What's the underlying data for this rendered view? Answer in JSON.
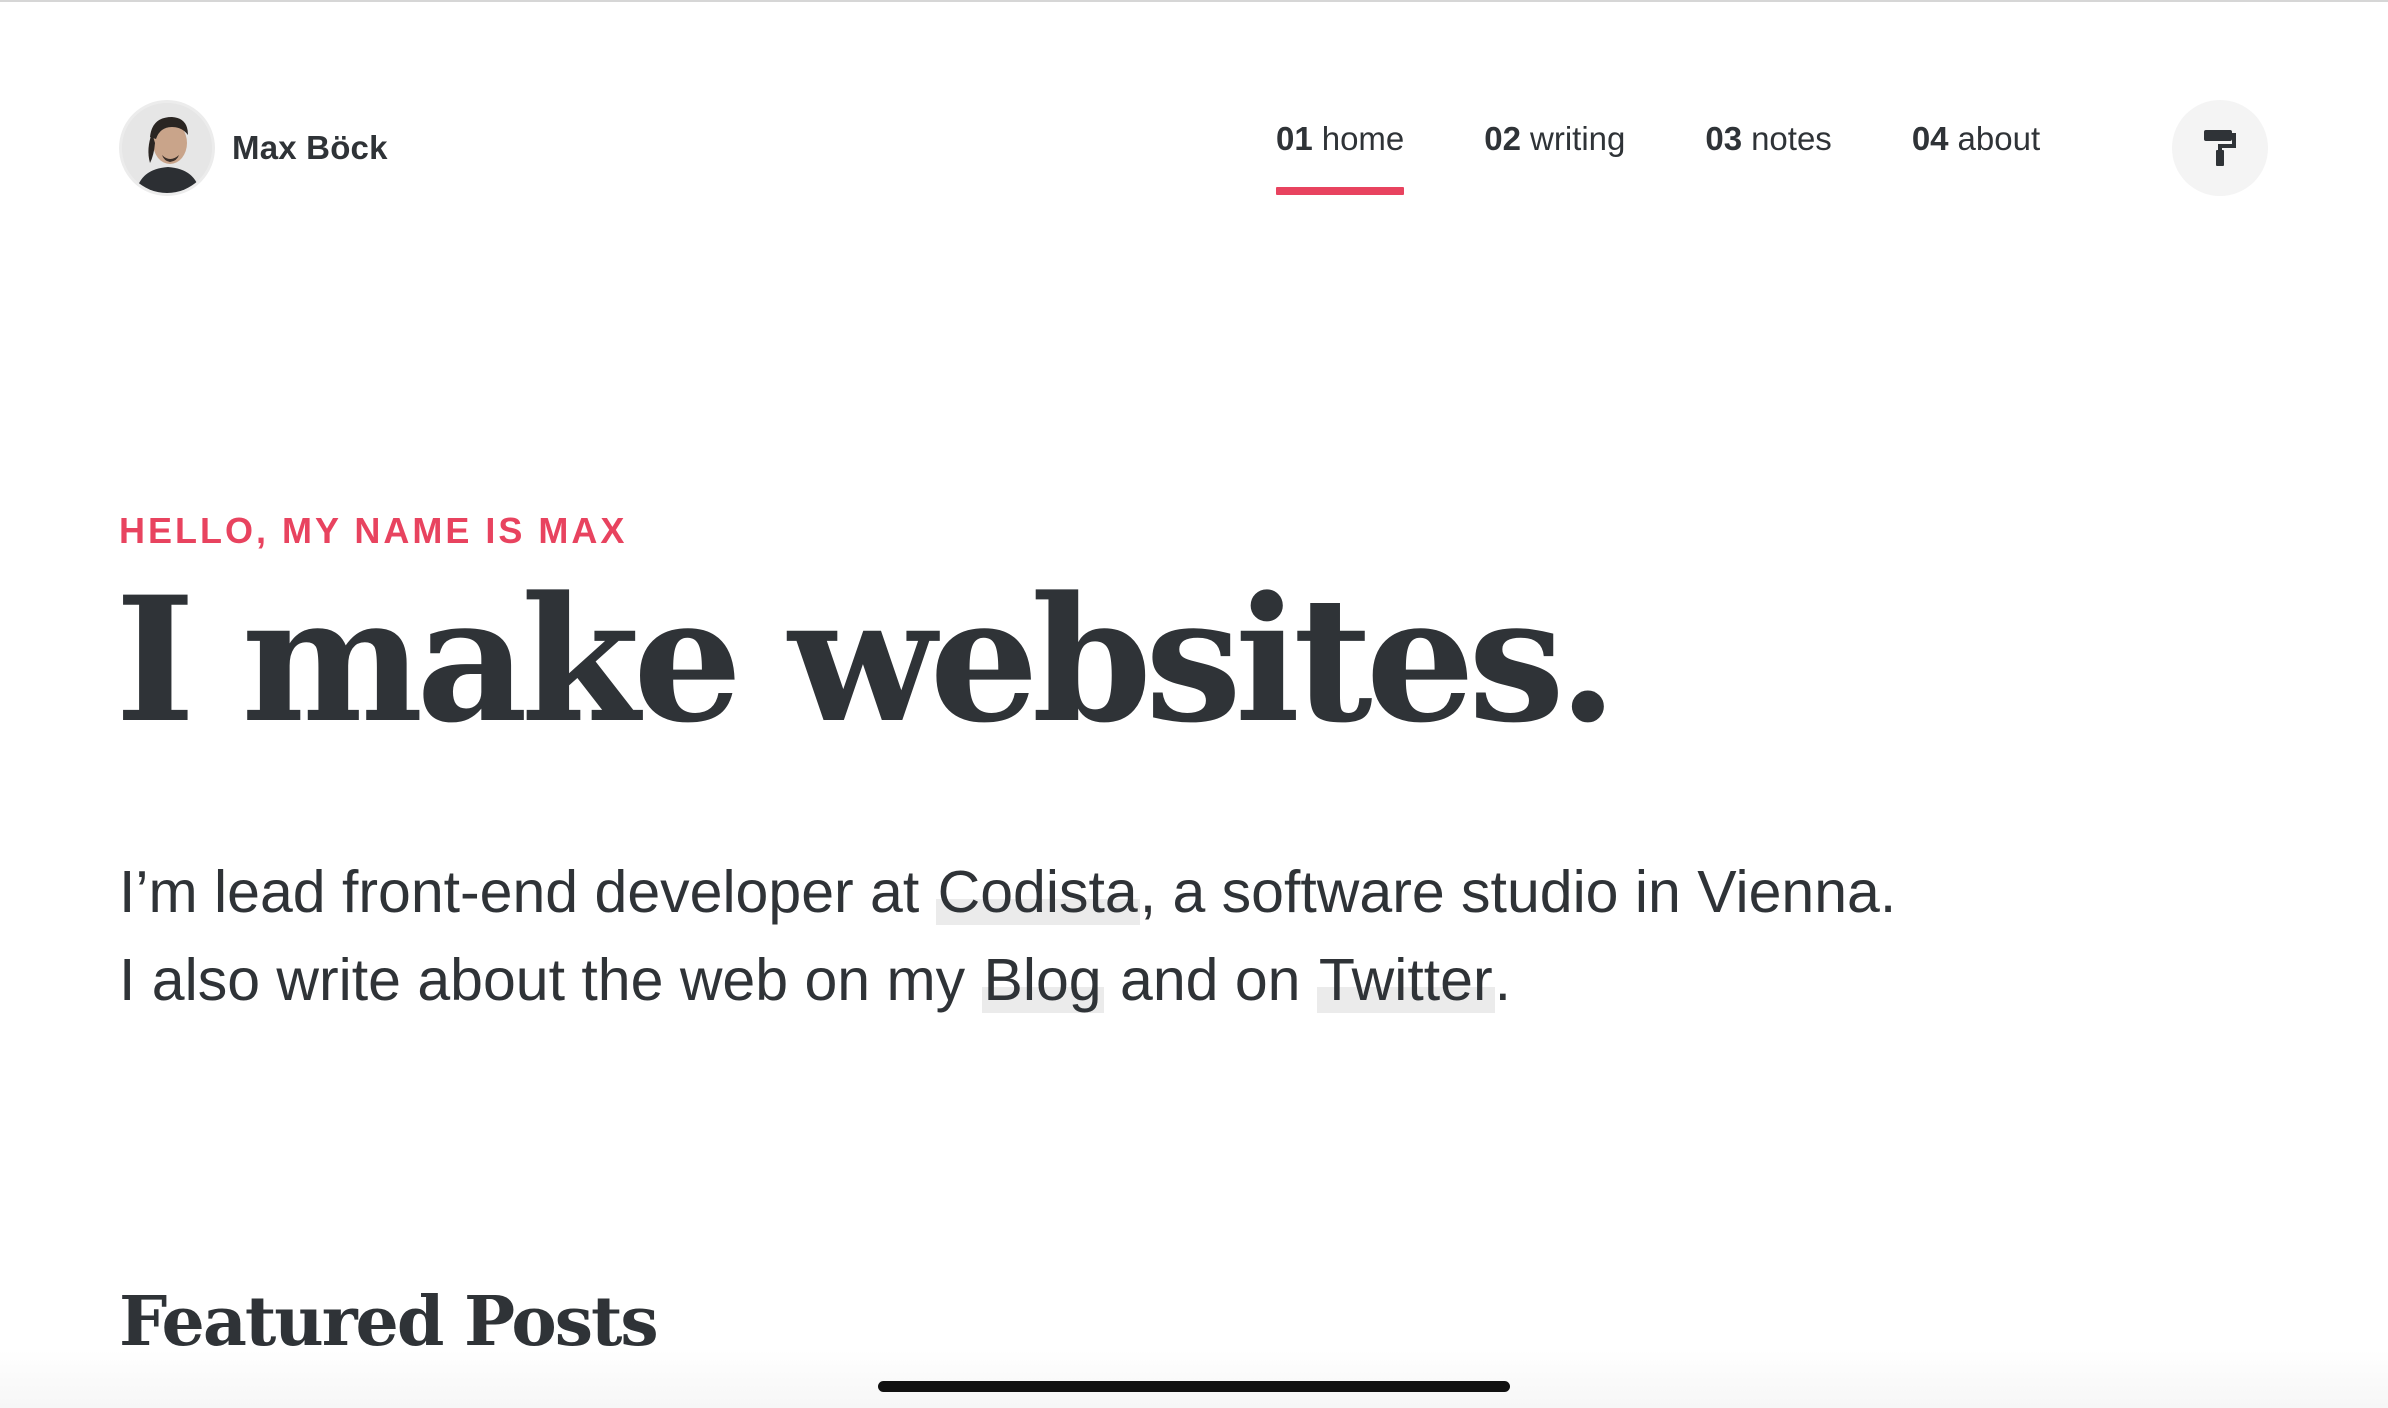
{
  "header": {
    "brand_name": "Max Böck",
    "avatar_alt": "Max Böck",
    "nav": [
      {
        "num": "01",
        "label": "home",
        "active": true
      },
      {
        "num": "02",
        "label": "writing",
        "active": false
      },
      {
        "num": "03",
        "label": "notes",
        "active": false
      },
      {
        "num": "04",
        "label": "about",
        "active": false
      }
    ],
    "theme_button_icon": "paint-roller-icon"
  },
  "hero": {
    "kicker": "HELLO, MY NAME IS MAX",
    "title": "I make websites.",
    "line1_prefix": "I’m lead front-end developer at ",
    "line1_link": "Codista",
    "line1_suffix": ", a software studio in Vienna.",
    "line2_prefix": "I also write about the web on my ",
    "line2_link1": "Blog",
    "line2_middle": " and on ",
    "line2_link2": "Twitter",
    "line2_suffix": "."
  },
  "featured": {
    "title": "Featured Posts"
  },
  "colors": {
    "accent": "#e8435f",
    "text": "#2f3337",
    "link_highlight": "#ebebeb",
    "button_bg": "#f4f4f4"
  }
}
